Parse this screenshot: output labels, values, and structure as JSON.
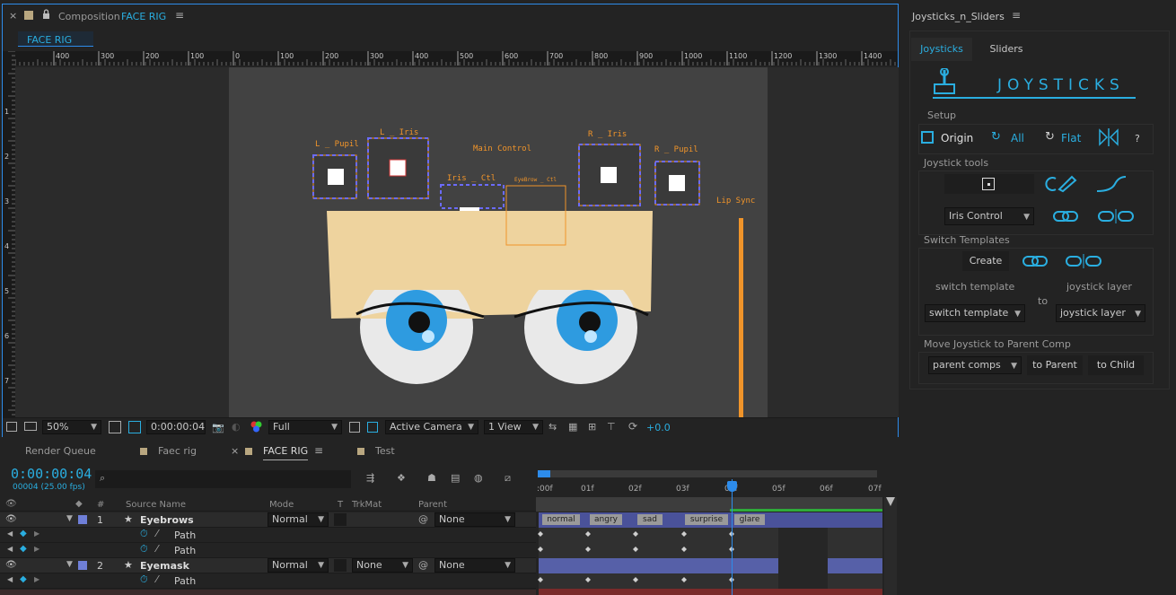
{
  "comp": {
    "title_prefix": "Composition",
    "title_name": "FACE RIG",
    "tab": "FACE RIG",
    "ruler_labels": [
      "400",
      "300",
      "200",
      "100",
      "0",
      "100",
      "200",
      "300",
      "400",
      "500",
      "600",
      "700",
      "800",
      "900",
      "1000",
      "1100",
      "1200",
      "1300",
      "1400"
    ],
    "vruler_labels": [
      "1",
      "2",
      "3",
      "4",
      "5",
      "6",
      "7"
    ],
    "labels": {
      "l_pupil": "L _ Pupil",
      "l_iris": "L _ Iris",
      "main_control": "Main Control",
      "iris_ctl": "Iris _ Ctl",
      "eyebrow_ctl": "EyeBrow _ Ctl",
      "r_iris": "R _ Iris",
      "r_pupil": "R _ Pupil",
      "lip_sync": "Lip Sync"
    },
    "toolbar": {
      "zoom": "50%",
      "timecode": "0:00:00:04",
      "resolution": "Full",
      "camera": "Active Camera",
      "view": "1 View",
      "exposure": "+0.0"
    }
  },
  "timeline": {
    "tabs": [
      "Render Queue",
      "Faec rig",
      "FACE RIG",
      "Test"
    ],
    "timecode": "0:00:00:04",
    "fps": "00004 (25.00 fps)",
    "search_placeholder": "",
    "headers": {
      "num": "#",
      "source": "Source Name",
      "mode": "Mode",
      "t": "T",
      "trkmat": "TrkMat",
      "parent": "Parent"
    },
    "time_labels": [
      ":00f",
      "01f",
      "02f",
      "03f",
      "04f",
      "05f",
      "06f",
      "07f"
    ],
    "layers": [
      {
        "num": "1",
        "name": "Eyebrows",
        "mode": "Normal",
        "trkmat": "",
        "parent": "None",
        "color": "#6f7fd8"
      },
      {
        "num": "",
        "name": "Path"
      },
      {
        "num": "",
        "name": "Path"
      },
      {
        "num": "2",
        "name": "Eyemask",
        "mode": "Normal",
        "trkmat": "None",
        "parent": "None",
        "color": "#6f7fd8"
      },
      {
        "num": "",
        "name": "Path"
      }
    ],
    "markers": [
      "normal",
      "angry",
      "sad",
      "surprise",
      "glare"
    ]
  },
  "panel": {
    "title": "Joysticks_n_Sliders",
    "tabs": [
      "Joysticks",
      "Sliders"
    ],
    "header": "JOYSTICKS",
    "setup_label": "Setup",
    "setup_buttons": [
      "Origin",
      "All",
      "Flat",
      "?"
    ],
    "tools_label": "Joystick tools",
    "iris_dropdown": "Iris Control",
    "switch_label": "Switch Templates",
    "create": "Create",
    "switch_template_label": "switch template",
    "joystick_layer_label": "joystick layer",
    "to": "to",
    "switch_template_dd": "switch template",
    "joystick_layer_dd": "joystick layer",
    "move_label": "Move Joystick to Parent Comp",
    "parent_comps": "parent comps",
    "to_parent": "to Parent",
    "to_child": "to Child"
  },
  "colors": {
    "accent": "#2aaee0",
    "selection_blue": "#2d8ceb",
    "orange": "#f0942a",
    "skin": "#eed39e",
    "iris": "#2e9be0"
  }
}
